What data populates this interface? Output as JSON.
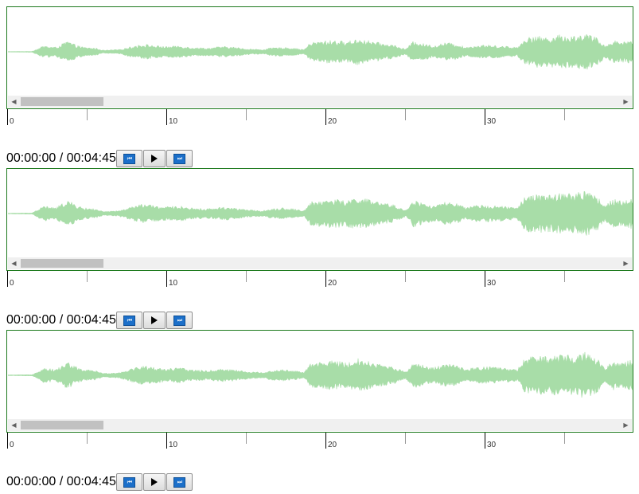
{
  "colors": {
    "waveform": "#a8dda8",
    "border": "#1e7a1e",
    "button_icon": "#1b6fc9"
  },
  "timeline": {
    "labels": [
      "0",
      "10",
      "20",
      "30"
    ]
  },
  "players": [
    {
      "time_display": "00:00:00 / 00:04:45",
      "buttons": [
        {
          "name": "skip-backward",
          "icon": "skip-back-icon"
        },
        {
          "name": "play",
          "icon": "play-icon"
        },
        {
          "name": "skip-forward",
          "icon": "skip-forward-icon"
        }
      ]
    },
    {
      "time_display": "00:00:00 / 00:04:45",
      "buttons": [
        {
          "name": "skip-backward",
          "icon": "skip-back-icon"
        },
        {
          "name": "play",
          "icon": "play-icon"
        },
        {
          "name": "skip-forward",
          "icon": "skip-forward-icon"
        }
      ]
    },
    {
      "time_display": "00:00:00 / 00:04:45",
      "buttons": [
        {
          "name": "skip-backward",
          "icon": "skip-back-icon"
        },
        {
          "name": "play",
          "icon": "play-icon"
        },
        {
          "name": "skip-forward",
          "icon": "skip-forward-icon"
        }
      ]
    }
  ]
}
